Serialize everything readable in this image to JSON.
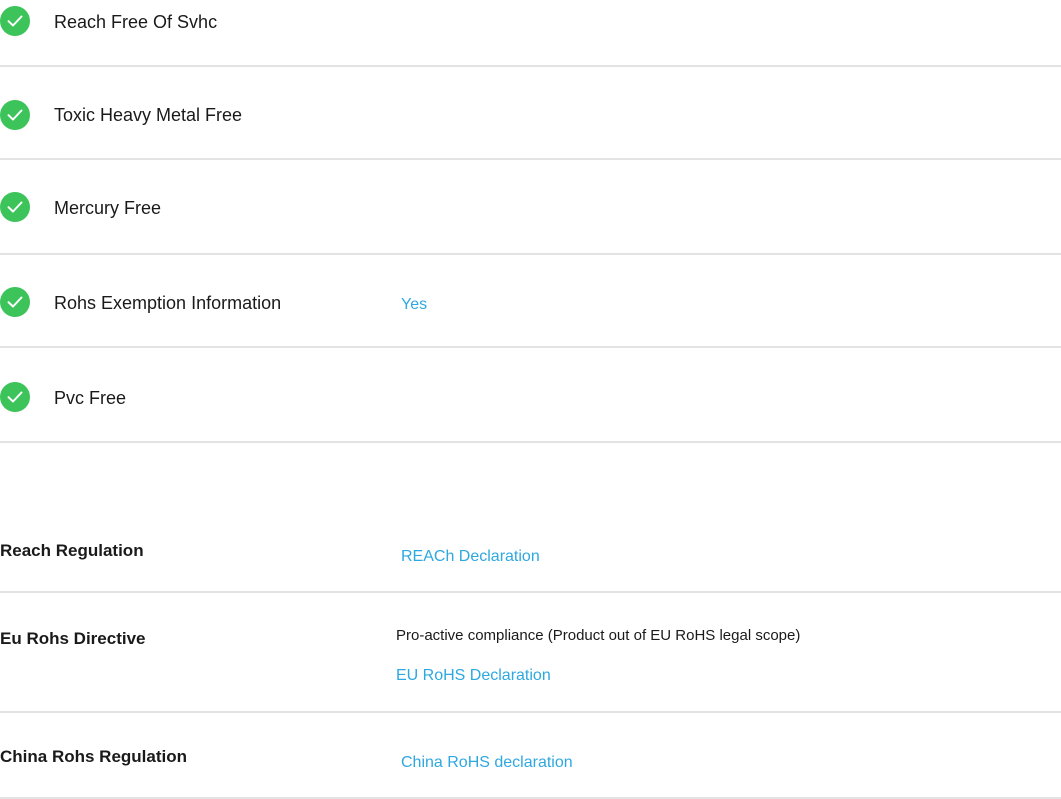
{
  "features": [
    {
      "label": "Reach Free Of Svhc",
      "value": "",
      "icon": "check-circle-icon"
    },
    {
      "label": "Toxic Heavy Metal Free",
      "value": "",
      "icon": "check-circle-icon"
    },
    {
      "label": "Mercury Free",
      "value": "",
      "icon": "check-circle-icon"
    },
    {
      "label": "Rohs Exemption Information",
      "value": "Yes",
      "icon": "check-circle-icon"
    },
    {
      "label": "Pvc Free",
      "value": "",
      "icon": "check-circle-icon"
    }
  ],
  "regulations": [
    {
      "label": "Reach Regulation",
      "text": "",
      "link": "REACh Declaration"
    },
    {
      "label": "Eu Rohs Directive",
      "text": "Pro-active compliance (Product out of EU RoHS legal scope)",
      "link": "EU RoHS Declaration"
    },
    {
      "label": "China Rohs Regulation",
      "text": "",
      "link": "China RoHS declaration"
    }
  ],
  "colors": {
    "check": "#3cc45a",
    "link": "#2ea8e0",
    "divider": "#e3e3e3",
    "text": "#1a1a1a"
  }
}
